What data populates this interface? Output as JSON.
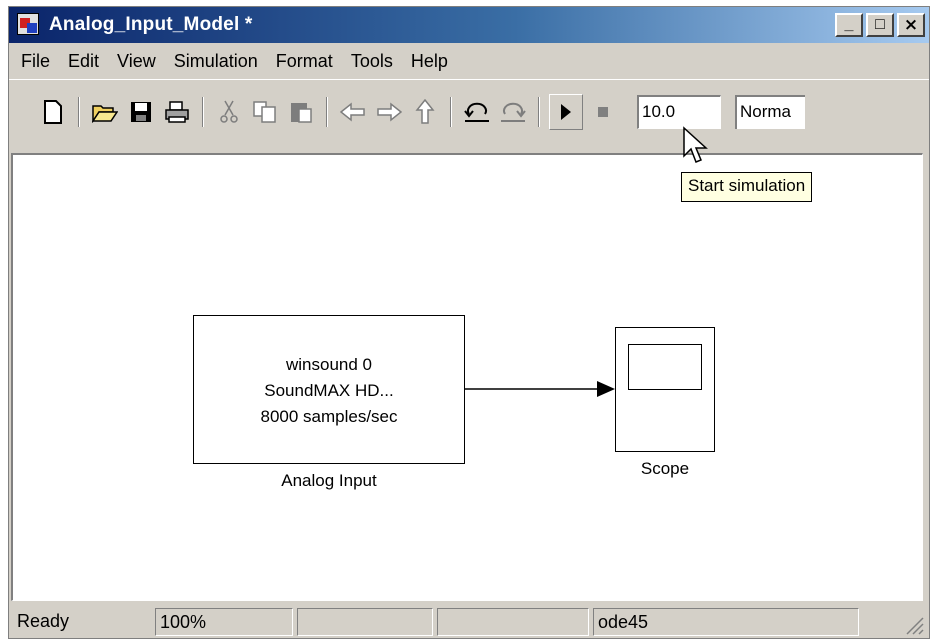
{
  "window": {
    "title": "Analog_Input_Model *",
    "minimize": "_",
    "maximize": "□",
    "close": "×"
  },
  "menu": [
    "File",
    "Edit",
    "View",
    "Simulation",
    "Format",
    "Tools",
    "Help"
  ],
  "toolbar": {
    "icons": [
      "new-icon",
      "open-icon",
      "save-icon",
      "print-icon",
      "cut-icon",
      "copy-icon",
      "paste-icon",
      "back-icon",
      "forward-icon",
      "up-icon",
      "undo-icon",
      "redo-icon",
      "start-icon",
      "stop-icon"
    ],
    "stop_time": "10.0",
    "sim_mode": "Norma"
  },
  "tooltip": "Start simulation",
  "blocks": {
    "analog_input": {
      "lines": [
        "winsound 0",
        "SoundMAX HD...",
        "8000 samples/sec"
      ],
      "label": "Analog Input"
    },
    "scope": {
      "label": "Scope"
    }
  },
  "status": {
    "ready": "Ready",
    "zoom": "100%",
    "field3": "",
    "field4": "",
    "solver": "ode45"
  }
}
